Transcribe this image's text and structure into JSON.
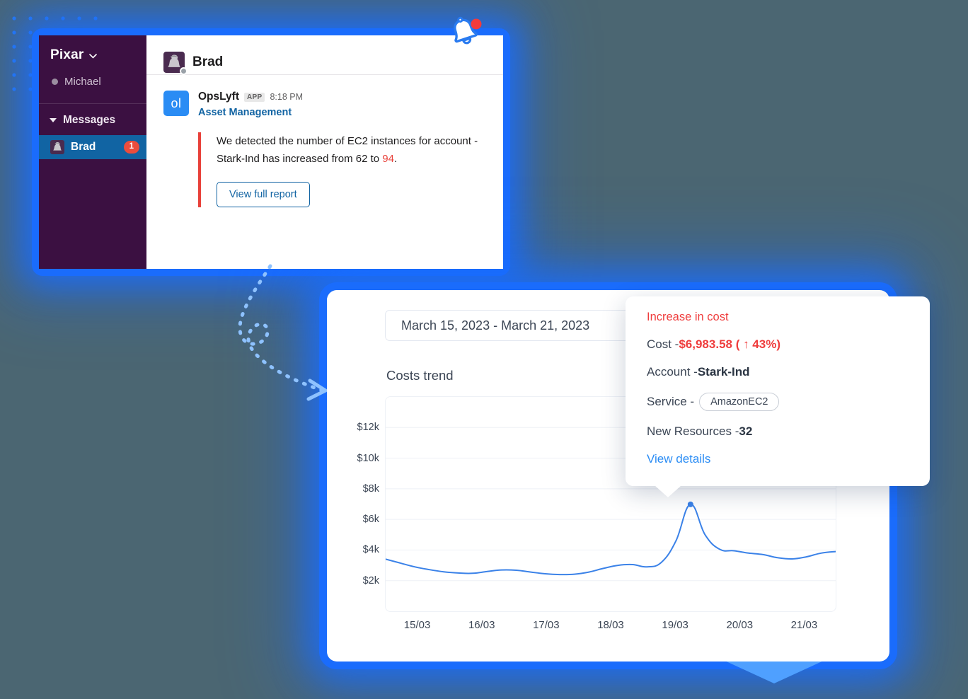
{
  "colors": {
    "background": "#4b6672",
    "glow_blue": "#1a6cfc",
    "slack_sidebar": "#3b1041",
    "slack_selected": "#1164a3",
    "slack_link": "#1264a3",
    "alert_red": "#e8413a",
    "tooltip_red": "#ef3d3d",
    "chart_line": "#3b82e8",
    "badge_red": "#eb4d3d",
    "app_icon_blue": "#2a8cf4"
  },
  "decor": {
    "bell_icon": "bell-notification-icon",
    "arrow_icon": "curved-dashed-arrow-icon",
    "dots_icon": "dot-grid-decoration"
  },
  "slack": {
    "workspace": "Pixar",
    "workspace_chevron": "chevron-down-icon",
    "current_user": "Michael",
    "section_label": "Messages",
    "channel": {
      "name": "Brad",
      "unread": "1"
    },
    "conversation_header": {
      "name": "Brad",
      "presence": "away"
    },
    "message": {
      "app_icon_text": "ol",
      "app_name": "OpsLyft",
      "app_tag": "APP",
      "time": "8:18 PM",
      "subtitle": "Asset Management",
      "body_part1": "We detected the number of EC2 instances for account - Stark-Ind has increased from 62 to ",
      "body_highlight": "94",
      "body_part2": ".",
      "button": "View full report"
    }
  },
  "dashboard": {
    "date_range": "March 15, 2023 - March 21, 2023",
    "chart_title": "Costs trend"
  },
  "tooltip": {
    "heading": "Increase in cost",
    "cost_label": "Cost - ",
    "cost_value": "$6,983.58 ( ↑ 43%)",
    "account_label": "Account - ",
    "account_value": "Stark-Ind",
    "service_label": "Service - ",
    "service_value": "AmazonEC2",
    "resources_label": "New Resources - ",
    "resources_value": "32",
    "link": "View details"
  },
  "chart_data": {
    "type": "line",
    "title": "Costs trend",
    "xlabel": "",
    "ylabel": "",
    "ylim": [
      0,
      14000
    ],
    "grid": true,
    "legend": null,
    "ytick_labels": [
      "$12k",
      "$10k",
      "$8k",
      "$6k",
      "$4k",
      "$2k"
    ],
    "ytick_values": [
      12000,
      10000,
      8000,
      6000,
      4000,
      2000
    ],
    "categories": [
      "15/03",
      "16/03",
      "17/03",
      "18/03",
      "19/03",
      "20/03",
      "21/03"
    ],
    "x": [
      0,
      0.25,
      0.5,
      0.75,
      1,
      1.25,
      1.5,
      1.75,
      2,
      2.25,
      2.5,
      2.75,
      3,
      3.25,
      3.5,
      3.75,
      4,
      4.25,
      4.5,
      4.75,
      5,
      5.25,
      5.5,
      5.75,
      6,
      6.25
    ],
    "series": [
      {
        "name": "Cost",
        "color": "#3b82e8",
        "values": [
          3400,
          3150,
          2900,
          2720,
          2580,
          2500,
          2480,
          2600,
          2700,
          2680,
          2560,
          2450,
          2400,
          2420,
          2560,
          2800,
          3000,
          3050,
          2900,
          3200,
          4600,
          6983,
          5000,
          4050,
          3950,
          3800
        ]
      }
    ],
    "highlight_point": {
      "x": "19/03",
      "value": 6983.58,
      "label": "$6,983.58",
      "change_pct": 43
    },
    "tail_values": [
      3700,
      3500,
      3420,
      3560,
      3800,
      3900
    ]
  }
}
